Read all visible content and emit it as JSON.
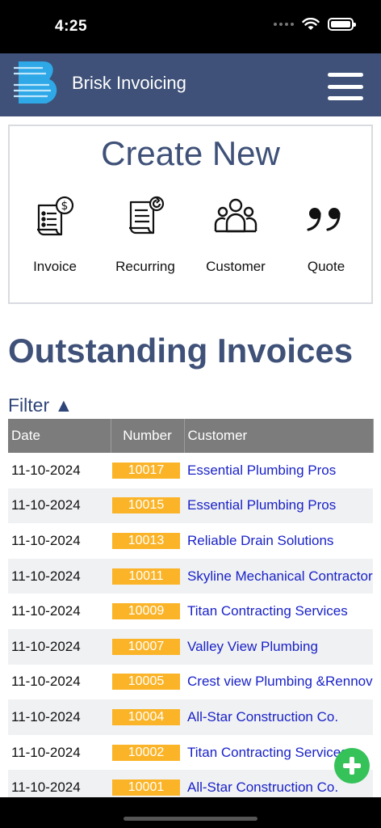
{
  "status_bar": {
    "time": "4:25"
  },
  "header": {
    "title": "Brisk Invoicing",
    "logo": "brisk-b-logo",
    "menu_icon": "hamburger-icon"
  },
  "create_new": {
    "title": "Create New",
    "items": [
      {
        "label": "Invoice",
        "icon": "invoice-dollar-icon"
      },
      {
        "label": "Recurring",
        "icon": "recurring-invoice-icon"
      },
      {
        "label": "Customer",
        "icon": "customers-group-icon"
      },
      {
        "label": "Quote",
        "icon": "quote-marks-icon"
      }
    ]
  },
  "outstanding": {
    "title": "Outstanding Invoices",
    "filter_label": "Filter ▲",
    "columns": [
      "Date",
      "Number",
      "Customer"
    ],
    "rows": [
      {
        "date": "11-10-2024",
        "number": "10017",
        "customer": "Essential Plumbing Pros"
      },
      {
        "date": "11-10-2024",
        "number": "10015",
        "customer": "Essential Plumbing Pros"
      },
      {
        "date": "11-10-2024",
        "number": "10013",
        "customer": "Reliable Drain Solutions"
      },
      {
        "date": "11-10-2024",
        "number": "10011",
        "customer": "Skyline Mechanical Contractors"
      },
      {
        "date": "11-10-2024",
        "number": "10009",
        "customer": "Titan Contracting Services"
      },
      {
        "date": "11-10-2024",
        "number": "10007",
        "customer": "Valley View Plumbing"
      },
      {
        "date": "11-10-2024",
        "number": "10005",
        "customer": "Crest view Plumbing &Rennovation"
      },
      {
        "date": "11-10-2024",
        "number": "10004",
        "customer": "All-Star Construction Co."
      },
      {
        "date": "11-10-2024",
        "number": "10002",
        "customer": "Titan Contracting Services"
      },
      {
        "date": "11-10-2024",
        "number": "10001",
        "customer": "All-Star Construction Co."
      }
    ]
  },
  "colors": {
    "header_bg": "#3f5178",
    "title": "#3f5178",
    "number_badge": "#fbb428",
    "customer_link": "#1a22c8",
    "fab": "#35c259",
    "table_header": "#7c7c7c"
  },
  "fab_icon": "plus-icon"
}
